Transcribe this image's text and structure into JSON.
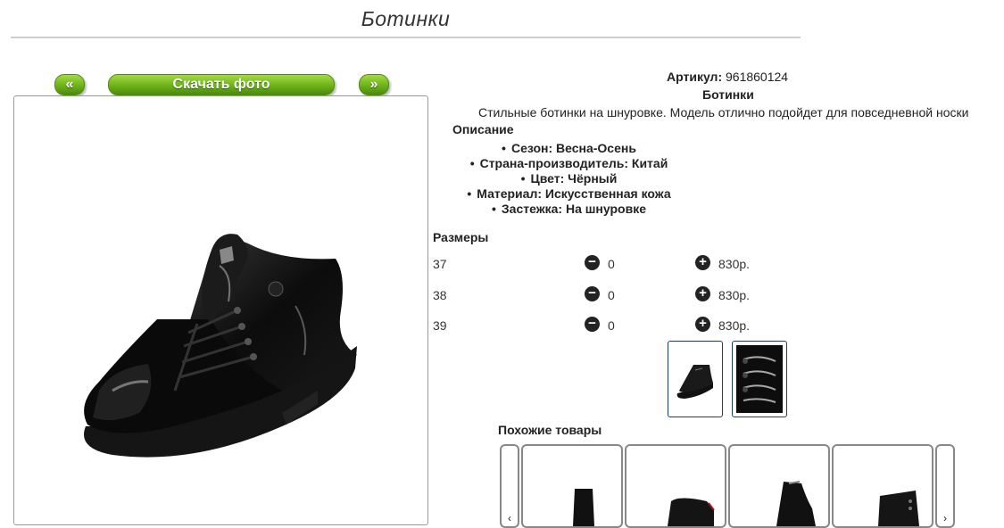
{
  "page": {
    "title": "Ботинки"
  },
  "gallery": {
    "prev_label": "«",
    "download_label": "Скачать фото",
    "next_label": "»"
  },
  "product": {
    "article_label": "Артикул:",
    "article_value": "961860124",
    "name": "Ботинки",
    "short_description": "Стильные ботинки на шнуровке. Модель отлично подойдет для повседневной носки",
    "description_heading": "Описание",
    "properties": [
      "Сезон: Весна-Осень",
      "Страна-производитель: Китай",
      "Цвет: Чёрный",
      "Материал: Искусственная кожа",
      "Застежка: На шнуровке"
    ]
  },
  "sizes": {
    "heading": "Размеры",
    "rows": [
      {
        "size": "37",
        "qty": "0",
        "price": "830р."
      },
      {
        "size": "38",
        "qty": "0",
        "price": "830р."
      },
      {
        "size": "39",
        "qty": "0",
        "price": "830р."
      }
    ]
  },
  "similar": {
    "heading": "Похожие товары"
  },
  "icons": {
    "minus": "minus-circle-icon",
    "plus": "plus-circle-icon"
  }
}
